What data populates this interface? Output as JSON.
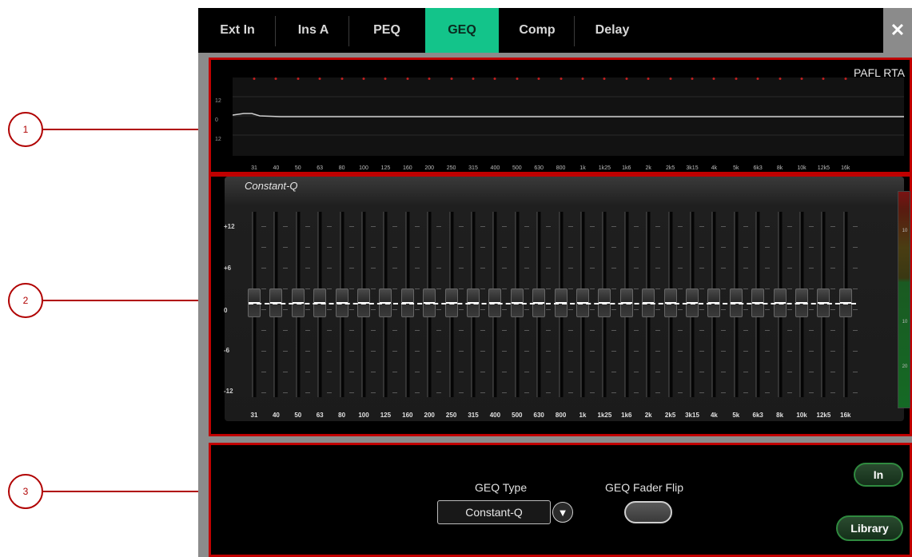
{
  "tabs": [
    {
      "label": "Ext In"
    },
    {
      "label": "Ins A"
    },
    {
      "label": "PEQ"
    },
    {
      "label": "GEQ"
    },
    {
      "label": "Comp"
    },
    {
      "label": "Delay"
    }
  ],
  "active_tab": "GEQ",
  "close_icon": "✕",
  "callouts": [
    "1",
    "2",
    "3"
  ],
  "rta": {
    "title": "PAFL RTA",
    "y_labels": [
      "12",
      "0",
      "12"
    ]
  },
  "frequencies": [
    "31",
    "40",
    "50",
    "63",
    "80",
    "100",
    "125",
    "160",
    "200",
    "250",
    "315",
    "400",
    "500",
    "630",
    "800",
    "1k",
    "1k25",
    "1k6",
    "2k",
    "2k5",
    "3k15",
    "4k",
    "5k",
    "6k3",
    "8k",
    "10k",
    "12k5",
    "16k"
  ],
  "fader_panel": {
    "title": "Constant-Q",
    "db_labels": [
      "+12",
      "+6",
      "0",
      "-6",
      "-12"
    ],
    "meter_labels": [
      "10",
      "10",
      "20"
    ]
  },
  "fader_values_db": [
    0,
    0,
    0,
    0,
    0,
    0,
    0,
    0,
    0,
    0,
    0,
    0,
    0,
    0,
    0,
    0,
    0,
    0,
    0,
    0,
    0,
    0,
    0,
    0,
    0,
    0,
    0,
    0
  ],
  "bottom": {
    "geq_type_label": "GEQ Type",
    "geq_type_value": "Constant-Q",
    "fader_flip_label": "GEQ Fader Flip",
    "in_button": "In",
    "library_button": "Library",
    "dropdown_icon": "▼"
  },
  "colors": {
    "accent_active_tab": "#13c48a",
    "callout_red": "#c00000",
    "button_green": "#2f8a3f"
  }
}
